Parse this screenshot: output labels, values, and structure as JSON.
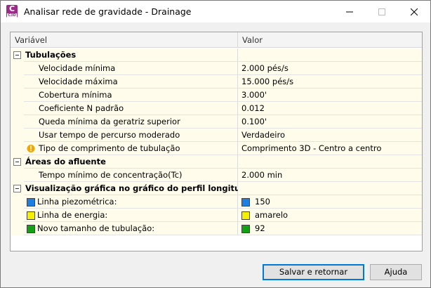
{
  "window": {
    "title": "Analisar rede de gravidade - Drainage",
    "app_icon_letter": "C",
    "app_icon_sub": "C3D"
  },
  "grid": {
    "col_variable": "Variável",
    "col_value": "Valor",
    "rows": [
      {
        "type": "category",
        "label": "Tubulações",
        "value": ""
      },
      {
        "type": "item",
        "label": "Velocidade mínima",
        "value": "2.000 pés/s"
      },
      {
        "type": "item",
        "label": "Velocidade máxima",
        "value": "15.000 pés/s"
      },
      {
        "type": "item",
        "label": "Cobertura mínima",
        "value": "3.000'"
      },
      {
        "type": "item",
        "label": "Coeficiente N padrão",
        "value": "0.012"
      },
      {
        "type": "item",
        "label": "Queda mínima da geratriz superior",
        "value": "0.100'"
      },
      {
        "type": "item",
        "label": "Usar tempo de percurso moderado",
        "value": "Verdadeiro"
      },
      {
        "type": "item-warn",
        "label": "Tipo de comprimento de tubulação",
        "value": "Comprimento 3D - Centro a centro"
      },
      {
        "type": "category",
        "label": "Áreas do afluente",
        "value": ""
      },
      {
        "type": "item",
        "label": "Tempo mínimo de concentração(Tc)",
        "value": "2.000 min"
      },
      {
        "type": "category",
        "label": "Visualização gráfica no gráfico do perfil longitudinal",
        "value": ""
      },
      {
        "type": "swatch",
        "label": "Linha piezométrica:",
        "value": "150",
        "color": "#1e7fe0"
      },
      {
        "type": "swatch",
        "label": "Linha de energia:",
        "value": "amarelo",
        "color": "#f5f000"
      },
      {
        "type": "swatch",
        "label": "Novo tamanho de tubulação:",
        "value": "92",
        "color": "#14a014"
      }
    ]
  },
  "buttons": {
    "save": "Salvar e retornar",
    "help": "Ajuda"
  }
}
